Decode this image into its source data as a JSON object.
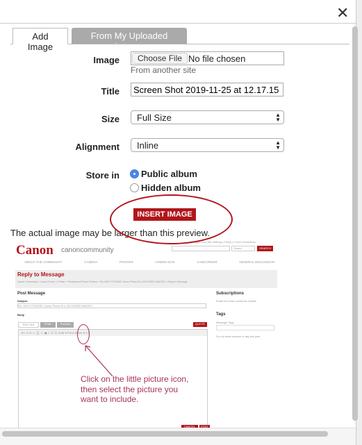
{
  "dialog": {
    "close_icon": "close-x-icon"
  },
  "tabs": [
    {
      "label": "Add Image",
      "active": true
    },
    {
      "label": "From My Uploaded Images",
      "active": false
    }
  ],
  "form": {
    "image_label": "Image",
    "choose_file": "Choose File",
    "no_file": "No file chosen",
    "from_site": "From another site",
    "title_label": "Title",
    "title_value": "Screen Shot 2019-11-25 at 12.17.15 PM",
    "size_label": "Size",
    "size_value": "Full Size",
    "alignment_label": "Alignment",
    "alignment_value": "Inline",
    "store_label": "Store in",
    "store_options": [
      {
        "label": "Public album",
        "selected": true
      },
      {
        "label": "Hidden album",
        "selected": false
      }
    ],
    "insert_button": "INSERT IMAGE"
  },
  "preview_note": "The actual image may be larger than this preview.",
  "preview": {
    "logo": "Canon",
    "community": "canoncommunity",
    "top_links": "Sign Out | My Settings | FAQs | Forum Guidelines",
    "board": "Board",
    "search": "SEARCH",
    "nav": [
      "ABOUT THE COMMUNITY",
      "CAMERA",
      "PRINTER",
      "CINEMA EOS",
      "CAMCORDER",
      "GENERAL DISCUSSION"
    ],
    "heading": "Reply to Message",
    "breadcrumb": "Canon Community > Canon Forum > Printer > Professional Photo Printers > Re: HELP PLEASE! Canon Pixma Pro 100 FADED IMAGES > Reply to Message",
    "post_message": "Post Message",
    "subject_label": "Subject",
    "subject_value": "Re: HELP PLEASE! Canon Pixma Pro 100 FADED IMAGES",
    "body_label": "Body",
    "editor_tabs": [
      "Rich Text",
      "HTML",
      "Preview"
    ],
    "quote": "QUOTE",
    "toolbar": "B I U S ☺ {¦} ☺ ▣ ≡ ☰ ☰ Arial ▾ Font Sizes ▾ A ▾",
    "subscriptions": "Subscriptions",
    "email_me": "Email me when someone replies",
    "tags": "Tags",
    "message_tags": "Message Tags",
    "no_tag": "Do not allow anyone to tag this post",
    "annotation": "Click on the little picture icon, then select the picture you want to include.",
    "cancel": "CANCEL",
    "post": "POST",
    "accent": "#b0161b",
    "annotation_color": "#a8325a"
  }
}
